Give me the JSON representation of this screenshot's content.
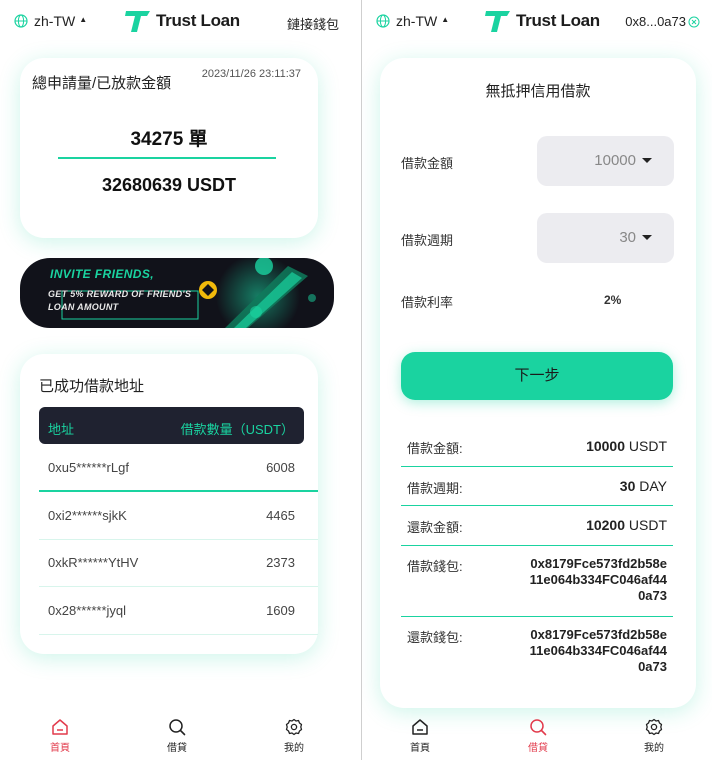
{
  "colors": {
    "accent": "#1ad3a0",
    "active_nav": "#e23a4b",
    "dark_header": "#1f2230",
    "banner_bg": "#11121a"
  },
  "left": {
    "header": {
      "lang": "zh-TW",
      "logo_text": "Trust Loan",
      "connect_label": "鏈接錢包"
    },
    "stats": {
      "title": "總申請量/已放款金額",
      "datetime": "2023/11/26 23:11:37",
      "orders": "34275 單",
      "amount": "32680639 USDT"
    },
    "banner": {
      "line1": "INVITE FRIENDS,",
      "line2": "GET 5% REWARD OF FRIEND'S",
      "line3": "LOAN AMOUNT"
    },
    "list": {
      "title": "已成功借款地址",
      "col_address": "地址",
      "col_amount": "借款數量（USDT）",
      "rows": [
        {
          "address": "0xu5******rLgf",
          "amount": "6008"
        },
        {
          "address": "0xi2******sjkK",
          "amount": "4465"
        },
        {
          "address": "0xkR******YtHV",
          "amount": "2373"
        },
        {
          "address": "0x28******jyql",
          "amount": "1609"
        }
      ]
    },
    "nav": [
      {
        "label": "首頁",
        "icon": "home-icon",
        "active": true
      },
      {
        "label": "借貸",
        "icon": "search-icon",
        "active": false
      },
      {
        "label": "我的",
        "icon": "gear-icon",
        "active": false
      }
    ]
  },
  "right": {
    "header": {
      "lang": "zh-TW",
      "logo_text": "Trust Loan",
      "wallet": "0x8...0a73"
    },
    "form": {
      "title": "無抵押信用借款",
      "amount_label": "借款金額",
      "amount_value": "10000",
      "period_label": "借款週期",
      "period_value": "30",
      "rate_label": "借款利率",
      "rate_value": "2%",
      "next_label": "下一步"
    },
    "summary": {
      "amount_label": "借款金額:",
      "amount_value": "10000",
      "amount_unit": " USDT",
      "period_label": "借款週期:",
      "period_value": "30",
      "period_unit": " DAY",
      "repay_label": "還款金額:",
      "repay_value": "10200",
      "repay_unit": " USDT",
      "borrow_wallet_label": "借款錢包:",
      "borrow_wallet": "0x8179Fce573fd2b58e11e064b334FC046af440a73",
      "repay_wallet_label": "還款錢包:",
      "repay_wallet": "0x8179Fce573fd2b58e11e064b334FC046af440a73"
    },
    "nav": [
      {
        "label": "首頁",
        "icon": "home-icon",
        "active": false
      },
      {
        "label": "借貸",
        "icon": "search-icon",
        "active": true
      },
      {
        "label": "我的",
        "icon": "gear-icon",
        "active": false
      }
    ]
  }
}
